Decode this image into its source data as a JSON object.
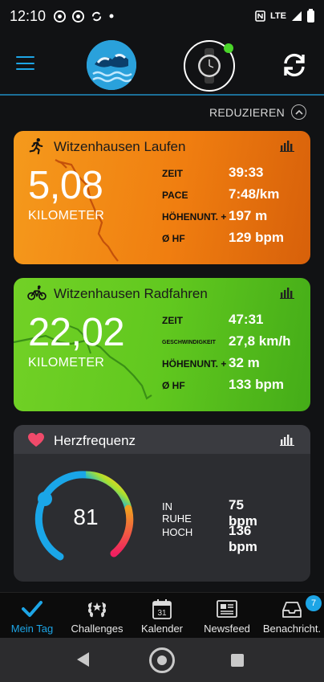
{
  "status_bar": {
    "time": "12:10",
    "network": "LTE"
  },
  "header": {
    "menu_icon": "hamburger-menu-icon",
    "sync_icon": "sync-icon"
  },
  "collapse_label": "REDUZIEREN",
  "cards": {
    "run": {
      "title": "Witzenhausen Laufen",
      "distance": "5,08",
      "unit": "KILOMETER",
      "stats": [
        {
          "label": "ZEIT",
          "value": "39:33"
        },
        {
          "label": "PACE",
          "value": "7:48/km"
        },
        {
          "label": "HÖHENUNT. +",
          "value": "197 m"
        },
        {
          "label": "Ø HF",
          "value": "129 bpm"
        }
      ]
    },
    "bike": {
      "title": "Witzenhausen Radfahren",
      "distance": "22,02",
      "unit": "KILOMETER",
      "stats": [
        {
          "label": "ZEIT",
          "value": "47:31"
        },
        {
          "label": "GESCHWINDIGKEIT",
          "value": "27,8 km/h"
        },
        {
          "label": "HÖHENUNT. +",
          "value": "32 m"
        },
        {
          "label": "Ø HF",
          "value": "133 bpm"
        }
      ]
    },
    "heart": {
      "title": "Herzfrequenz",
      "current": "81",
      "stats": [
        {
          "label": "IN RUHE",
          "value": "75 bpm"
        },
        {
          "label": "HOCH",
          "value": "136 bpm"
        }
      ]
    }
  },
  "bottom_nav": {
    "items": [
      {
        "label": "Mein Tag",
        "icon": "checkmark-icon"
      },
      {
        "label": "Challenges",
        "icon": "laurel-icon"
      },
      {
        "label": "Kalender",
        "icon": "calendar-icon",
        "day": "31"
      },
      {
        "label": "Newsfeed",
        "icon": "newspaper-icon"
      },
      {
        "label": "Benachricht.",
        "icon": "inbox-icon",
        "badge": "7"
      }
    ]
  },
  "colors": {
    "accent": "#1da5e6",
    "run_card": "#f08a14",
    "bike_card": "#62c820",
    "heart_card": "#2c2d31"
  }
}
